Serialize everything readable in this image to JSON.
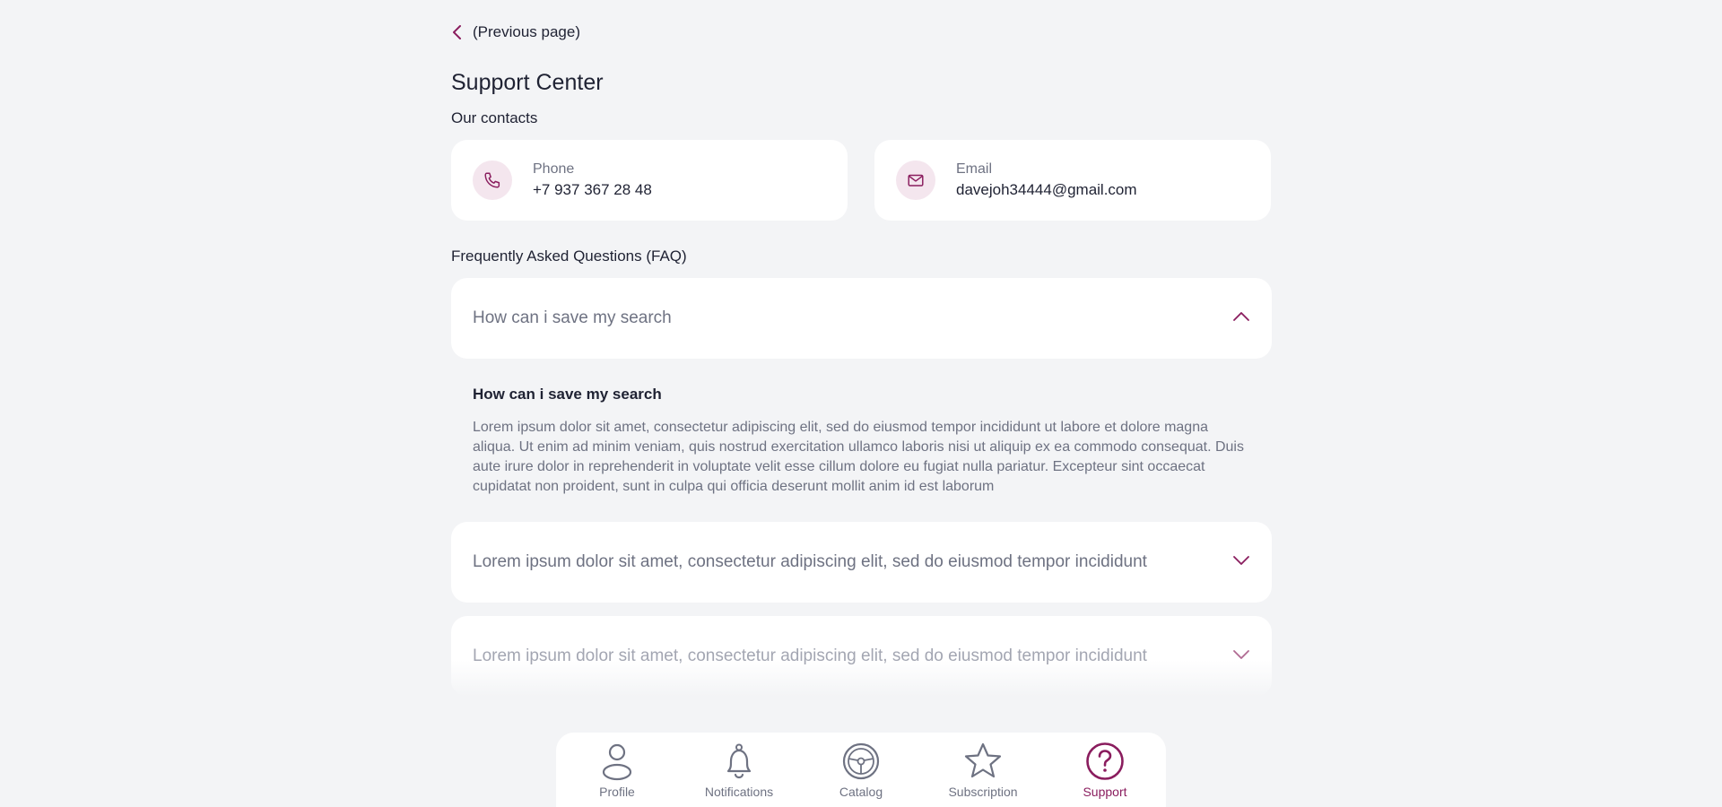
{
  "colors": {
    "accent": "#8a1d5e",
    "background": "#f3f4f6",
    "card": "#ffffff",
    "text": "#1f2233",
    "muted": "#6e7282"
  },
  "header": {
    "back_label": "(Previous page)",
    "title": "Support Center"
  },
  "contacts": {
    "heading": "Our contacts",
    "phone": {
      "label": "Phone",
      "value": "+7 937 367 28 48",
      "icon": "phone-icon"
    },
    "email": {
      "label": "Email",
      "value": "davejoh34444@gmail.com",
      "icon": "mail-icon"
    }
  },
  "faq": {
    "heading": "Frequently Asked Questions (FAQ)",
    "items": [
      {
        "question": "How can i save my search",
        "expanded": true,
        "answer_title": "How can i save my search",
        "answer": "Lorem ipsum dolor sit amet, consectetur adipiscing elit, sed do eiusmod tempor incididunt ut labore et dolore magna aliqua. Ut enim ad minim veniam, quis nostrud exercitation ullamco laboris nisi ut aliquip ex ea commodo consequat. Duis aute irure dolor in reprehenderit in voluptate velit esse cillum dolore eu fugiat nulla pariatur. Excepteur sint occaecat cupidatat non proident, sunt in culpa qui officia deserunt mollit anim id est laborum"
      },
      {
        "question": "Lorem ipsum dolor sit amet, consectetur adipiscing elit, sed do eiusmod tempor incididunt",
        "expanded": false
      },
      {
        "question": "Lorem ipsum dolor sit amet, consectetur adipiscing elit, sed do eiusmod tempor incididunt",
        "expanded": false
      }
    ]
  },
  "nav": {
    "items": [
      {
        "label": "Profile",
        "icon": "user-icon",
        "active": false
      },
      {
        "label": "Notifications",
        "icon": "bell-icon",
        "active": false
      },
      {
        "label": "Catalog",
        "icon": "steering-wheel-icon",
        "active": false
      },
      {
        "label": "Subscription",
        "icon": "star-icon",
        "active": false
      },
      {
        "label": "Support",
        "icon": "help-icon",
        "active": true
      }
    ]
  }
}
